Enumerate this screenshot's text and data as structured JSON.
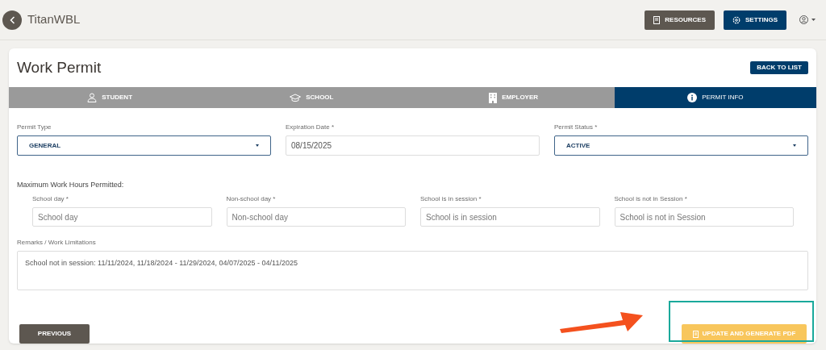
{
  "header": {
    "app_name": "TitanWBL",
    "buttons": [
      {
        "label": "RESOURCES",
        "kind": "resources"
      },
      {
        "label": "SETTINGS",
        "kind": "settings"
      }
    ]
  },
  "page": {
    "title": "Work Permit",
    "back_button": "BACK TO LIST"
  },
  "tabs": [
    {
      "label": "STUDENT",
      "kind": "student",
      "selected": false
    },
    {
      "label": "SCHOOL",
      "kind": "school",
      "selected": false
    },
    {
      "label": "EMPLOYER",
      "kind": "employer",
      "selected": false
    },
    {
      "label": "PERMIT INFO",
      "kind": "info",
      "selected": true
    }
  ],
  "fields": [
    {
      "label": "Permit Type",
      "kind": "select",
      "value": "GENERAL"
    },
    {
      "label": "Expiration Date *",
      "kind": "text",
      "value": "08/15/2025"
    },
    {
      "label": "Permit Status *",
      "kind": "select",
      "value": "ACTIVE"
    }
  ],
  "hours": {
    "label": "Maximum Work Hours Permitted:",
    "fields": [
      {
        "label": "School day *",
        "placeholder": "School day"
      },
      {
        "label": "Non-school day *",
        "placeholder": "Non-school day"
      },
      {
        "label": "School is in session *",
        "placeholder": "School is in session"
      },
      {
        "label": "School is not in Session *",
        "placeholder": "School is not in Session"
      }
    ]
  },
  "remarks": {
    "label": "Remarks / Work Limitations",
    "value": "School not in session: 11/11/2024, 11/18/2024 - 11/29/2024, 04/07/2025 - 04/11/2025"
  },
  "footer": {
    "previous": "PREVIOUS",
    "submit": "UPDATE AND GENERATE PDF"
  }
}
